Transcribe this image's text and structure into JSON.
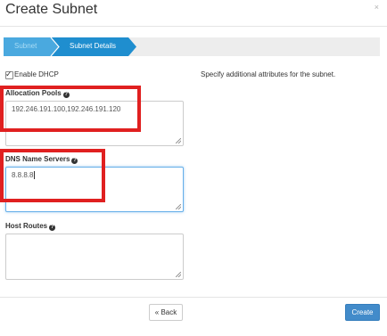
{
  "modal": {
    "title": "Create Subnet",
    "close_label": "×"
  },
  "wizard": {
    "steps": [
      {
        "label": "Subnet",
        "state": "inactive"
      },
      {
        "label": "Subnet Details",
        "state": "active"
      }
    ],
    "active_color": "#1f8ecf",
    "inactive_color": "#4aa9df"
  },
  "form": {
    "enable_dhcp": {
      "label": "Enable DHCP",
      "checked": true
    },
    "help_text": "Specify additional attributes for the subnet.",
    "allocation_pools": {
      "label": "Allocation Pools",
      "value": "192.246.191.100,192.246.191.120"
    },
    "dns_name_servers": {
      "label": "DNS Name Servers",
      "value": "8.8.8.8"
    },
    "host_routes": {
      "label": "Host Routes",
      "value": ""
    },
    "help_icon": "question-circle-icon"
  },
  "footer": {
    "back_label": "« Back",
    "create_label": "Create"
  },
  "colors": {
    "highlight_box": "#e02020",
    "primary_button": "#428bca"
  }
}
